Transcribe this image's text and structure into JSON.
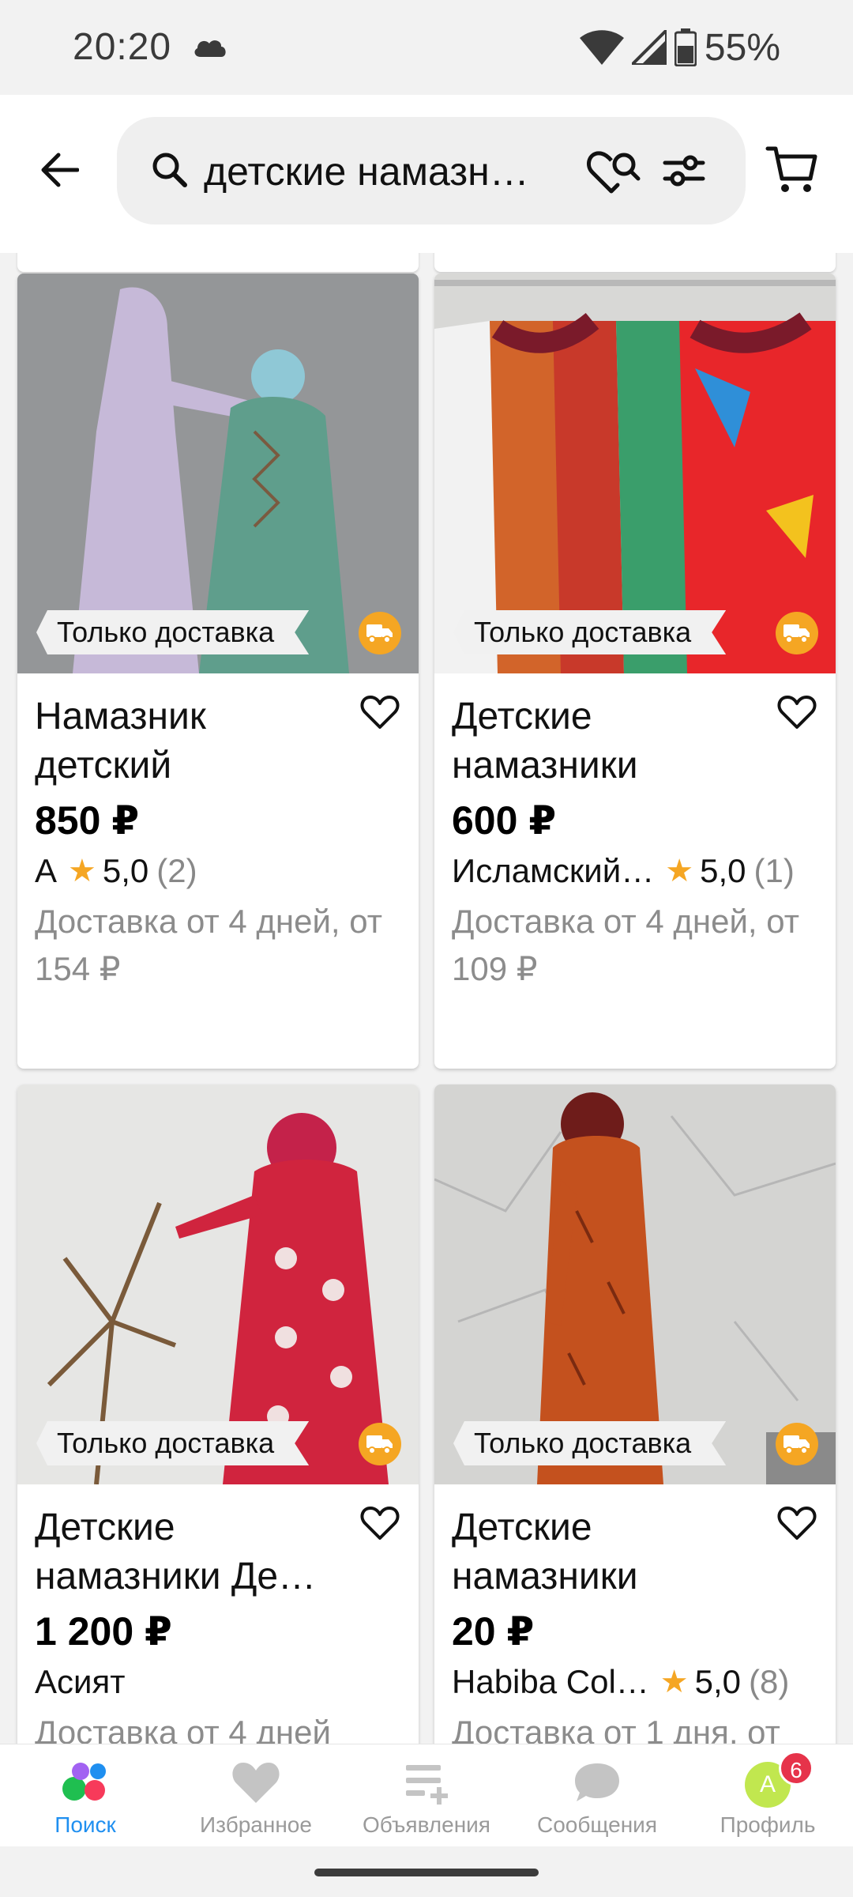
{
  "status_bar": {
    "time": "20:20",
    "battery": "55%"
  },
  "search": {
    "query": "детские намазн…"
  },
  "products": [
    {
      "badge": "Только доставка",
      "title": "Намазник детский",
      "price": "850 ₽",
      "seller": "А",
      "rating": "5,0",
      "reviews": "(2)",
      "delivery": "Доставка от 4 дней, от 154 ₽"
    },
    {
      "badge": "Только доставка",
      "title": "Детские намазники",
      "price": "600 ₽",
      "seller": "Исламский…",
      "rating": "5,0",
      "reviews": "(1)",
      "delivery": "Доставка от 4 дней, от 109 ₽"
    },
    {
      "badge": "Только доставка",
      "title": "Детские намазники Де…",
      "price": "1 200 ₽",
      "seller": "Асият",
      "delivery": "Доставка от 4 дней"
    },
    {
      "badge": "Только доставка",
      "title": "Детские намазники",
      "price": "20 ₽",
      "seller": "Habiba Col…",
      "rating": "5,0",
      "reviews": "(8)",
      "delivery": "Доставка от 1 дня, от"
    }
  ],
  "bottom_nav": {
    "search": "Поиск",
    "favorites": "Избранное",
    "ads": "Объявления",
    "messages": "Сообщения",
    "profile": "Профиль",
    "profile_initial": "А",
    "profile_badge": "6"
  },
  "colors": {
    "accent_blue": "#1f8ff0",
    "star": "#f5a623",
    "badge_red": "#e6334a",
    "avatar_green": "#c1e74f"
  }
}
